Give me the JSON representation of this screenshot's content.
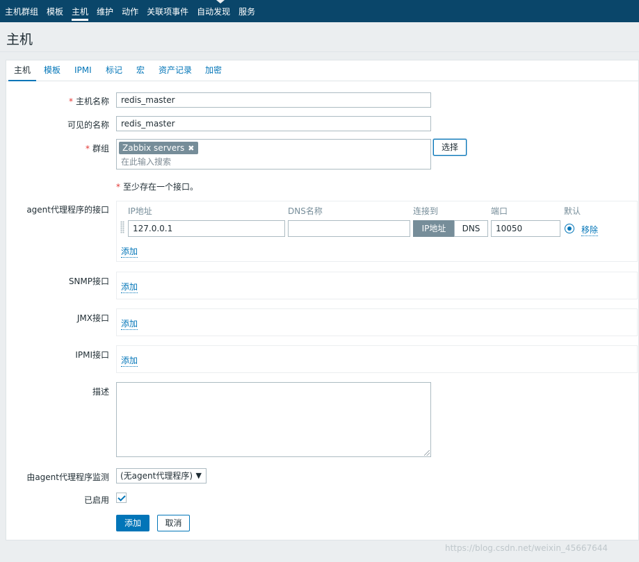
{
  "nav": {
    "items": [
      {
        "label": "主机群组"
      },
      {
        "label": "模板"
      },
      {
        "label": "主机"
      },
      {
        "label": "维护"
      },
      {
        "label": "动作"
      },
      {
        "label": "关联项事件"
      },
      {
        "label": "自动发现"
      },
      {
        "label": "服务"
      }
    ],
    "active": "主机"
  },
  "page": {
    "title": "主机"
  },
  "tabs": [
    {
      "label": "主机"
    },
    {
      "label": "模板"
    },
    {
      "label": "IPMI"
    },
    {
      "label": "标记"
    },
    {
      "label": "宏"
    },
    {
      "label": "资产记录"
    },
    {
      "label": "加密"
    }
  ],
  "form": {
    "host_name": {
      "label": "主机名称",
      "value": "redis_master"
    },
    "visible_name": {
      "label": "可见的名称",
      "value": "redis_master"
    },
    "groups": {
      "label": "群组",
      "selected": "Zabbix servers",
      "placeholder": "在此输入搜索",
      "select_button": "选择"
    },
    "interface_note": "至少存在一个接口。",
    "agent_iface": {
      "label": "agent代理程序的接口",
      "headers": {
        "ip": "IP地址",
        "dns": "DNS名称",
        "connect": "连接到",
        "port": "端口",
        "default": "默认"
      },
      "ip": "127.0.0.1",
      "dns": "",
      "connect_ip": "IP地址",
      "connect_dns": "DNS",
      "connect_selected": "IP地址",
      "port": "10050",
      "remove": "移除",
      "add": "添加"
    },
    "snmp_iface": {
      "label": "SNMP接口",
      "add": "添加"
    },
    "jmx_iface": {
      "label": "JMX接口",
      "add": "添加"
    },
    "ipmi_iface": {
      "label": "IPMI接口",
      "add": "添加"
    },
    "description": {
      "label": "描述",
      "value": ""
    },
    "proxy": {
      "label": "由agent代理程序监测",
      "value": "(无agent代理程序)"
    },
    "enabled": {
      "label": "已启用",
      "checked": true
    },
    "buttons": {
      "add": "添加",
      "cancel": "取消"
    }
  },
  "watermark": "https://blog.csdn.net/weixin_45667644"
}
